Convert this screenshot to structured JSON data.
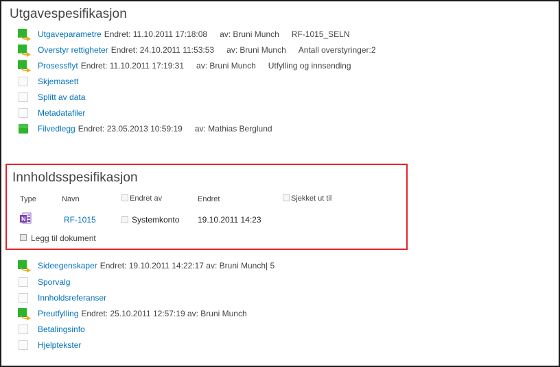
{
  "section1": {
    "title": "Utgavespesifikasjon",
    "items": [
      {
        "link": "Utgaveparametre",
        "meta": "Endret: 11.10.2011 17:18:08",
        "by": "av: Bruni Munch",
        "extra": "RF-1015_SELN",
        "icon": "green-arrow-icon"
      },
      {
        "link": "Overstyr rettigheter",
        "meta": "Endret: 24.10.2011 11:53:53",
        "by": "av: Bruni Munch",
        "extra": "Antall overstyringer:2",
        "icon": "green-arrow-icon"
      },
      {
        "link": "Prosessflyt",
        "meta": "Endret: 11.10.2011 17:19:31",
        "by": "av: Bruni Munch",
        "extra": "Utfylling og innsending",
        "icon": "green-arrow-icon"
      },
      {
        "link": "Skjemasett",
        "icon": "empty-checkbox-icon"
      },
      {
        "link": "Splitt av data",
        "icon": "empty-checkbox-icon"
      },
      {
        "link": "Metadatafiler",
        "icon": "empty-checkbox-icon"
      },
      {
        "link": "Filvedlegg",
        "meta": "Endret: 23.05.2013 10:59:19",
        "by": "av: Mathias Berglund",
        "icon": "green-square-icon"
      }
    ]
  },
  "section2": {
    "title": "Innholdsspesifikasjon",
    "columns": {
      "type": "Type",
      "name": "Navn",
      "modified_by": "Endret av",
      "modified": "Endret",
      "checked_out": "Sjekket ut til"
    },
    "row": {
      "icon": "onenote-icon",
      "name": "RF-1015",
      "modified_by": "Systemkonto",
      "modified": "19.10.2011 14:23"
    },
    "add_document": "Legg til dokument",
    "highlight_color": "#e3242b"
  },
  "section3": {
    "items": [
      {
        "link": "Sideegenskaper",
        "meta": "Endret: 19.10.2011 14:22:17 av: Bruni Munch| 5",
        "icon": "green-arrow-icon"
      },
      {
        "link": "Sporvalg",
        "icon": "empty-checkbox-icon"
      },
      {
        "link": "Innholdsreferanser",
        "icon": "empty-checkbox-icon"
      },
      {
        "link": "Preutfylling",
        "meta": "Endret: 25.10.2011 12:57:19 av: Bruni Munch",
        "icon": "green-arrow-icon"
      },
      {
        "link": "Betalingsinfo",
        "icon": "empty-checkbox-icon"
      },
      {
        "link": "Hjelptekster",
        "icon": "empty-checkbox-icon"
      }
    ]
  },
  "colors": {
    "link": "#0072bc",
    "text": "#444444",
    "green": "#2db42d",
    "arrow": "#f4a81d"
  }
}
